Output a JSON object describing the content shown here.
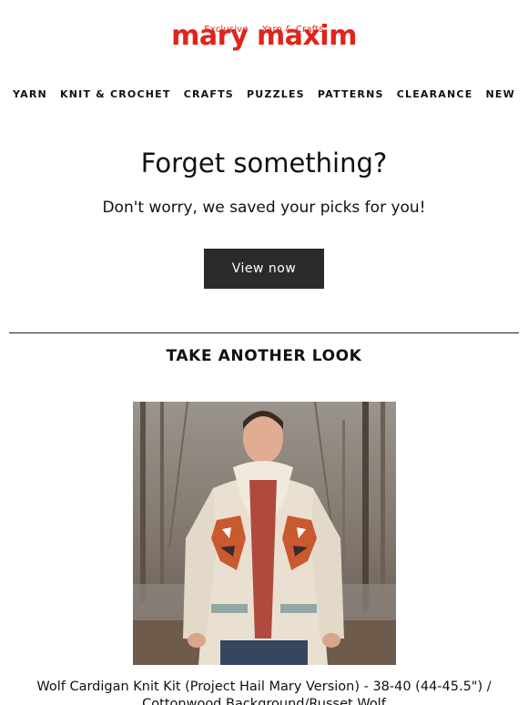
{
  "brand": {
    "name": "mary maxim",
    "tagline_left": "Exclusive",
    "tagline_right": "Yarn & Crafts",
    "color": "#e2231a"
  },
  "nav": {
    "items": [
      "YARN",
      "KNIT & CROCHET",
      "CRAFTS",
      "PUZZLES",
      "PATTERNS",
      "CLEARANCE",
      "NEW"
    ]
  },
  "hero": {
    "headline": "Forget something?",
    "subhead": "Don't worry, we saved your picks for you!",
    "cta_label": "View now",
    "cta_color": "#2b2b2b"
  },
  "section": {
    "title": "TAKE ANOTHER LOOK"
  },
  "product": {
    "name": "Wolf Cardigan Knit Kit (Project Hail Mary Version) - 38-40 (44-45.5\") / Cottonwood Background/Russet Wolf",
    "image_icon": "product-photo-icon"
  }
}
